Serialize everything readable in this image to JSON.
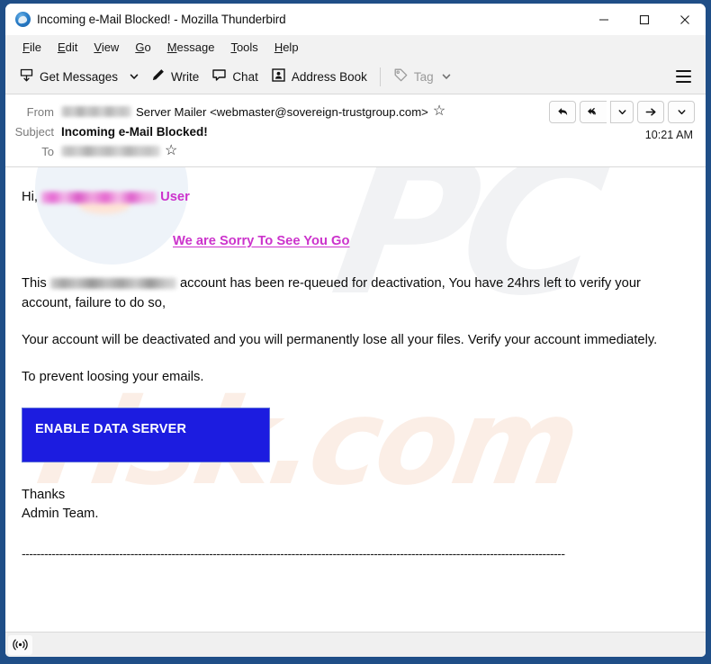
{
  "window": {
    "title": "Incoming e-Mail Blocked! - Mozilla Thunderbird",
    "logo_icon": "thunderbird-logo-icon",
    "controls": {
      "minimize": "minimize-icon",
      "maximize": "maximize-icon",
      "close": "close-icon"
    },
    "border_color": "#1f4e87"
  },
  "menubar": {
    "items": [
      {
        "accel": "F",
        "rest": "ile"
      },
      {
        "accel": "E",
        "rest": "dit"
      },
      {
        "accel": "V",
        "rest": "iew"
      },
      {
        "accel": "G",
        "rest": "o"
      },
      {
        "accel": "M",
        "rest": "essage"
      },
      {
        "accel": "T",
        "rest": "ools"
      },
      {
        "accel": "H",
        "rest": "elp"
      }
    ]
  },
  "toolbar": {
    "get_messages_label": "Get Messages",
    "write_label": "Write",
    "chat_label": "Chat",
    "address_book_label": "Address Book",
    "tag_label": "Tag",
    "menu_button": "app-menu-hamburger"
  },
  "message_header": {
    "from_label": "From",
    "from_redacted": true,
    "from_value": "Server Mailer <webmaster@sovereign-trustgroup.com>",
    "subject_label": "Subject",
    "subject_value": "Incoming e-Mail Blocked!",
    "to_label": "To",
    "to_redacted": true,
    "time": "10:21 AM",
    "star_glyph": "☆",
    "actions": {
      "reply": "reply-icon",
      "reply_all": "reply-all-icon",
      "reply_more": "chevron-down-icon",
      "forward": "forward-icon",
      "more": "chevron-down-icon"
    }
  },
  "body": {
    "greeting_prefix": "Hi,",
    "greeting_suffix": "User",
    "sorry_link": "We are Sorry To See You Go",
    "paragraph1_prefix": "This",
    "paragraph1_suffix": "account has been re-queued  for deactivation, You have 24hrs left to verify your account,  failure to do so,",
    "paragraph2": "Your account will be deactivated and you will permanently lose all your files.  Verify your account immediately.",
    "paragraph3": "To prevent loosing your emails.",
    "cta_label": "ENABLE DATA SERVER",
    "cta_color": "#1c1ce0",
    "signature_line1": "Thanks",
    "signature_line2": "Admin Team.",
    "divider": "-------------------------------------------------------------------------------------------------------------------------------------------------",
    "accent_color": "#cc33cc"
  },
  "watermark": {
    "text_top": "PC",
    "text_bottom": "risk.com",
    "color_top": "#f1f2f4",
    "color_bottom": "#fbeee6"
  },
  "statusbar": {
    "icon": "broadcast-icon"
  }
}
